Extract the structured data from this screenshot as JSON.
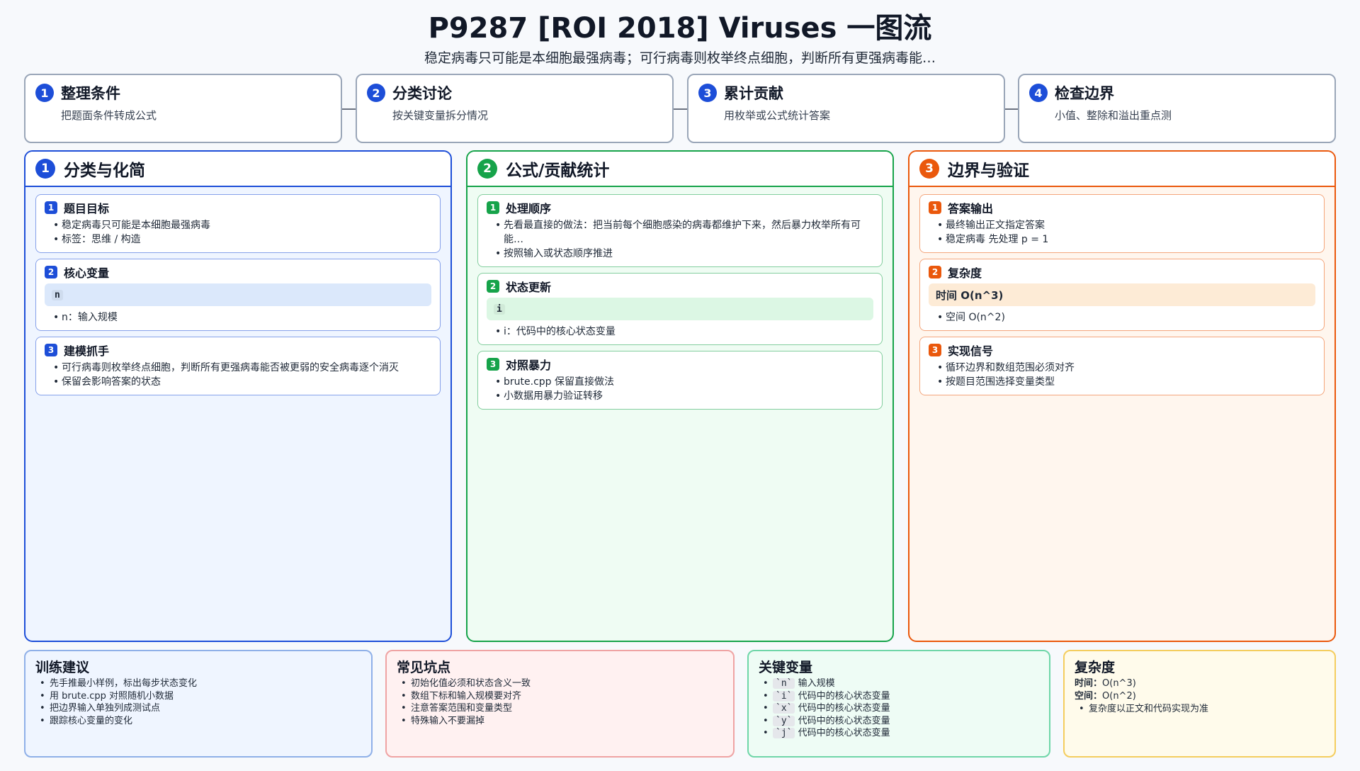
{
  "header": {
    "title": "P9287 [ROI 2018] Viruses 一图流",
    "subtitle": "稳定病毒只可能是本细胞最强病毒；可行病毒则枚举终点细胞，判断所有更强病毒能…"
  },
  "steps": [
    {
      "num": "1",
      "title": "整理条件",
      "desc": "把题面条件转成公式"
    },
    {
      "num": "2",
      "title": "分类讨论",
      "desc": "按关键变量拆分情况"
    },
    {
      "num": "3",
      "title": "累计贡献",
      "desc": "用枚举或公式统计答案"
    },
    {
      "num": "4",
      "title": "检查边界",
      "desc": "小值、整除和溢出重点测"
    }
  ],
  "columns": [
    {
      "num": "1",
      "title": "分类与化简",
      "color": "#1d4ed8",
      "bg": "#eff5ff",
      "code_bg": "#dbe8fb",
      "cards": [
        {
          "num": "1",
          "title": "题目目标",
          "items": [
            "稳定病毒只可能是本细胞最强病毒",
            "标签：思维 / 构造"
          ]
        },
        {
          "num": "2",
          "title": "核心变量",
          "code": "n",
          "items": [
            "n：输入规模"
          ]
        },
        {
          "num": "3",
          "title": "建模抓手",
          "items": [
            "可行病毒则枚举终点细胞，判断所有更强病毒能否被更弱的安全病毒逐个消灭",
            "保留会影响答案的状态"
          ]
        }
      ]
    },
    {
      "num": "2",
      "title": "公式/贡献统计",
      "color": "#16a34a",
      "bg": "#effcf3",
      "code_bg": "#dcf7e4",
      "cards": [
        {
          "num": "1",
          "title": "处理顺序",
          "items": [
            "先看最直接的做法：把当前每个细胞感染的病毒都维护下来，然后暴力枚举所有可能…",
            "按照输入或状态顺序推进"
          ]
        },
        {
          "num": "2",
          "title": "状态更新",
          "code": "i",
          "items": [
            "i：代码中的核心状态变量"
          ]
        },
        {
          "num": "3",
          "title": "对照暴力",
          "items": [
            "brute.cpp 保留直接做法",
            "小数据用暴力验证转移"
          ]
        }
      ]
    },
    {
      "num": "3",
      "title": "边界与验证",
      "color": "#ea580c",
      "bg": "#fff6ee",
      "code_bg": "#fdebd6",
      "cards": [
        {
          "num": "1",
          "title": "答案输出",
          "items": [
            "最终输出正文指定答案",
            "稳定病毒 先处理 p = 1"
          ]
        },
        {
          "num": "2",
          "title": "复杂度",
          "code_plain": "时间 O(n^3)",
          "items": [
            "空间 O(n^2)"
          ]
        },
        {
          "num": "3",
          "title": "实现信号",
          "items": [
            "循环边界和数组范围必须对齐",
            "按题目范围选择变量类型"
          ]
        }
      ]
    }
  ],
  "panels": {
    "training": {
      "title": "训练建议",
      "items": [
        "先手推最小样例，标出每步状态变化",
        "用 brute.cpp 对照随机小数据",
        "把边界输入单独列成测试点",
        "跟踪核心变量的变化"
      ]
    },
    "pitfalls": {
      "title": "常见坑点",
      "items": [
        "初始化值必须和状态含义一致",
        "数组下标和输入规模要对齐",
        "注意答案范围和变量类型",
        "特殊输入不要漏掉"
      ]
    },
    "variables": {
      "title": "关键变量",
      "items": [
        {
          "name": "`n`",
          "desc": "输入规模"
        },
        {
          "name": "`i`",
          "desc": "代码中的核心状态变量"
        },
        {
          "name": "`x`",
          "desc": "代码中的核心状态变量"
        },
        {
          "name": "`y`",
          "desc": "代码中的核心状态变量"
        },
        {
          "name": "`j`",
          "desc": "代码中的核心状态变量"
        }
      ]
    },
    "complexity": {
      "title": "复杂度",
      "time_label": "时间：",
      "time_value": "O(n^3)",
      "space_label": "空间：",
      "space_value": "O(n^2)",
      "note": "复杂度以正文和代码实现为准"
    }
  }
}
